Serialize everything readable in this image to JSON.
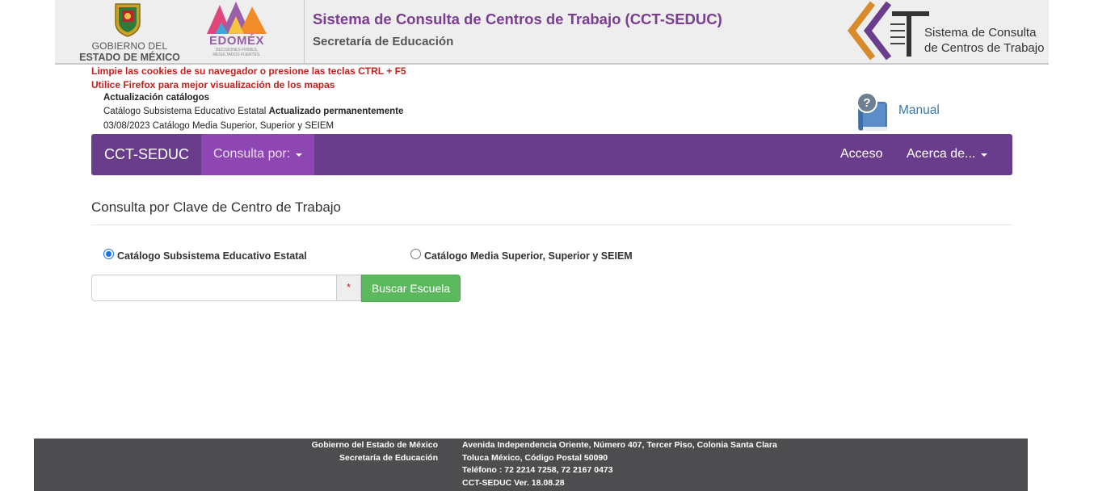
{
  "header": {
    "gov_line1": "GOBIERNO DEL",
    "gov_line2": "ESTADO DE MÉXICO",
    "edomex_word": "EDOMÉX",
    "edomex_tagline": "DECISIONES FIRMES, RESULTADOS FUERTES.",
    "title": "Sistema de Consulta de Centros de Trabajo (CCT-SEDUC)",
    "subtitle": "Secretaría de Educación",
    "cct_logo_line1": "Sistema de Consulta",
    "cct_logo_line2": "de Centros de Trabajo"
  },
  "notices": {
    "cookies": "Limpie las cookies de su navegador o presione las teclas CTRL + F5",
    "firefox": "Utilice Firefox para mejor visualización de los mapas",
    "update_title": "Actualización catálogos",
    "update_line1_prefix": "Catálogo Subsistema Educativo Estatal ",
    "update_line1_bold": "Actualizado permanentemente",
    "update_line2": "03/08/2023 Catálogo Media Superior, Superior y SEIEM"
  },
  "manual": {
    "label": "Manual",
    "icon": "help-book-icon"
  },
  "navbar": {
    "brand": "CCT-SEDUC",
    "consulta": "Consulta por:",
    "acceso": "Acceso",
    "acerca": "Acerca de...",
    "bg_color": "#6a3d8c",
    "active_color": "#8e46b3"
  },
  "main": {
    "heading": "Consulta por Clave de Centro de Trabajo",
    "radio_estatal": "Catálogo Subsistema Educativo Estatal",
    "radio_media": "Catálogo Media Superior, Superior y SEIEM",
    "selected_radio": "estatal",
    "search_value": "",
    "required_marker": "*",
    "search_button": "Buscar Escuela",
    "button_color": "#5cb85c"
  },
  "footer": {
    "left_line1": "Gobierno del Estado de México",
    "left_line2": "Secretaría de Educación",
    "right_line1": "Avenida Independencia Oriente, Número 407, Tercer Piso, Colonia Santa Clara",
    "right_line2": "Toluca México, Código Postal 50090",
    "right_line3": "Teléfono : 72 2214 7258, 72 2167 0473",
    "right_line4": "CCT-SEDUC Ver. 18.08.28"
  }
}
